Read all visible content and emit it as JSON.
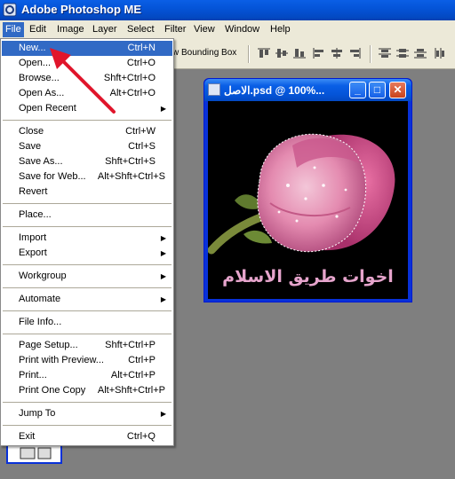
{
  "titlebar": {
    "title": "Adobe Photoshop ME"
  },
  "menubar": {
    "items": [
      {
        "label": "File"
      },
      {
        "label": "Edit"
      },
      {
        "label": "Image"
      },
      {
        "label": "Layer"
      },
      {
        "label": "Select"
      },
      {
        "label": "Filter"
      },
      {
        "label": "View"
      },
      {
        "label": "Window"
      },
      {
        "label": "Help"
      }
    ]
  },
  "options": {
    "bounding_box_label": "w Bounding Box"
  },
  "document": {
    "title": "الاصل.psd @ 100%...",
    "caption": "اخوات طريق الاسلام"
  },
  "file_menu": {
    "items": [
      {
        "label": "New...",
        "shortcut": "Ctrl+N"
      },
      {
        "label": "Open...",
        "shortcut": "Ctrl+O"
      },
      {
        "label": "Browse...",
        "shortcut": "Shft+Ctrl+O"
      },
      {
        "label": "Open As...",
        "shortcut": "Alt+Ctrl+O"
      },
      {
        "label": "Open Recent",
        "shortcut": ""
      },
      {
        "label": "Close",
        "shortcut": "Ctrl+W"
      },
      {
        "label": "Save",
        "shortcut": "Ctrl+S"
      },
      {
        "label": "Save As...",
        "shortcut": "Shft+Ctrl+S"
      },
      {
        "label": "Save for Web...",
        "shortcut": "Alt+Shft+Ctrl+S"
      },
      {
        "label": "Revert",
        "shortcut": ""
      },
      {
        "label": "Place...",
        "shortcut": ""
      },
      {
        "label": "Import",
        "shortcut": ""
      },
      {
        "label": "Export",
        "shortcut": ""
      },
      {
        "label": "Workgroup",
        "shortcut": ""
      },
      {
        "label": "Automate",
        "shortcut": ""
      },
      {
        "label": "File Info...",
        "shortcut": ""
      },
      {
        "label": "Page Setup...",
        "shortcut": "Shft+Ctrl+P"
      },
      {
        "label": "Print with Preview...",
        "shortcut": "Ctrl+P"
      },
      {
        "label": "Print...",
        "shortcut": "Alt+Ctrl+P"
      },
      {
        "label": "Print One Copy",
        "shortcut": "Alt+Shft+Ctrl+P"
      },
      {
        "label": "Jump To",
        "shortcut": ""
      },
      {
        "label": "Exit",
        "shortcut": "Ctrl+Q"
      }
    ]
  },
  "colors": {
    "selection": "#316ac5",
    "menu_bg": "#ece9d8",
    "workspace": "#7f7f7f",
    "annotation_arrow": "#e0152b",
    "rose_pink": "#e48bb0"
  },
  "icons": [
    "photoshop-app-icon",
    "align-icons",
    "document-icon",
    "minimize-icon",
    "maximize-icon",
    "close-icon",
    "submenu-arrow-icon"
  ]
}
